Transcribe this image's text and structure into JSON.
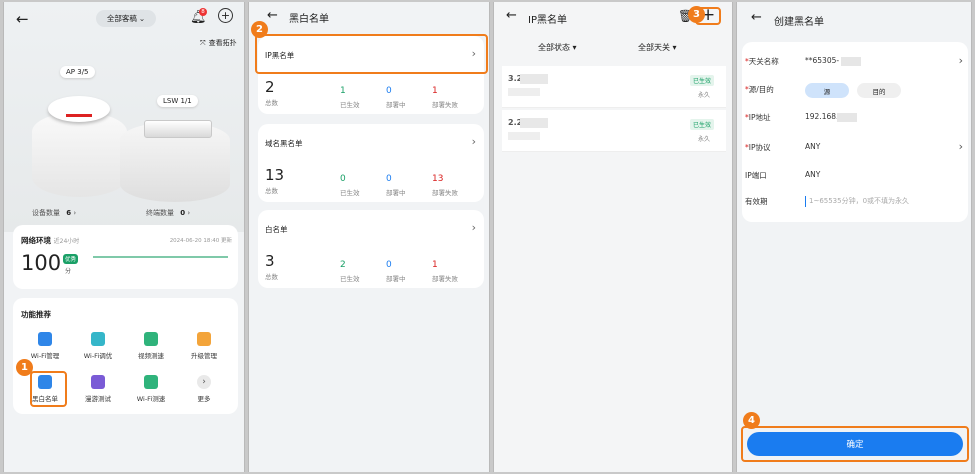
{
  "colors": {
    "accent": "#1a7cf0",
    "orange": "#f07c1b",
    "green": "#1aa067",
    "red": "#d9201f"
  },
  "p1": {
    "site_selector": "全部客稿",
    "bell_badge": "8",
    "topology_link": "查看拓扑",
    "ap_label": "AP 3/5",
    "lsw_label": "LSW 1/1",
    "device_count_label": "设备数量",
    "device_count": "6",
    "terminal_count_label": "终端数量",
    "terminal_count": "0",
    "network_title": "网络环境",
    "network_sub": "近24小时",
    "network_time": "2024-06-20 18:40 更新",
    "score": "100",
    "score_unit": "分",
    "score_badge": "优秀",
    "functions_title": "功能推荐",
    "functions": [
      {
        "label": "Wi-Fi管理",
        "icon": "wifi-manage-icon"
      },
      {
        "label": "Wi-Fi调优",
        "icon": "wifi-tune-icon"
      },
      {
        "label": "视频测速",
        "icon": "video-speed-icon"
      },
      {
        "label": "升级管理",
        "icon": "upgrade-icon"
      },
      {
        "label": "黑白名单",
        "icon": "blacklist-icon"
      },
      {
        "label": "漫游测试",
        "icon": "roaming-icon"
      },
      {
        "label": "Wi-Fi测速",
        "icon": "wifi-speed-icon"
      },
      {
        "label": "更多",
        "icon": "more-icon"
      }
    ],
    "step": "1"
  },
  "p2": {
    "title": "黑白名单",
    "step": "2",
    "cards": [
      {
        "name": "IP黑名单",
        "total": "2",
        "total_label": "总数",
        "s1": "1",
        "s1_label": "已生效",
        "s2": "0",
        "s2_label": "部署中",
        "s3": "1",
        "s3_label": "部署失败"
      },
      {
        "name": "域名黑名单",
        "total": "13",
        "total_label": "总数",
        "s1": "0",
        "s1_label": "已生效",
        "s2": "0",
        "s2_label": "部署中",
        "s3": "13",
        "s3_label": "部署失败"
      },
      {
        "name": "白名单",
        "total": "3",
        "total_label": "总数",
        "s1": "2",
        "s1_label": "已生效",
        "s2": "0",
        "s2_label": "部署中",
        "s3": "1",
        "s3_label": "部署失败"
      }
    ]
  },
  "p3": {
    "title": "IP黑名单",
    "step": "3",
    "filter_status": "全部状态 ▾",
    "filter_gateway": "全部天关 ▾",
    "items": [
      {
        "ip": "3.2",
        "status": "已生效",
        "validity": "永久"
      },
      {
        "ip": "2.2",
        "status": "已生效",
        "validity": "永久"
      }
    ]
  },
  "p4": {
    "title": "创建黑名单",
    "step": "4",
    "fields": [
      {
        "label": "天关名称",
        "required": "*",
        "value": "**65305-"
      },
      {
        "label": "源/目的",
        "required": "*",
        "value": ""
      },
      {
        "label": "IP地址",
        "required": "*",
        "value": "192.168."
      },
      {
        "label": "IP协议",
        "required": "*",
        "value": "ANY"
      },
      {
        "label": "IP端口",
        "required": "",
        "value": "ANY"
      },
      {
        "label": "有效期",
        "required": "",
        "value": ""
      }
    ],
    "src_option": "源",
    "dst_option": "目的",
    "validity_placeholder": "1~65535分钟，0或不填为永久",
    "confirm": "确定"
  }
}
